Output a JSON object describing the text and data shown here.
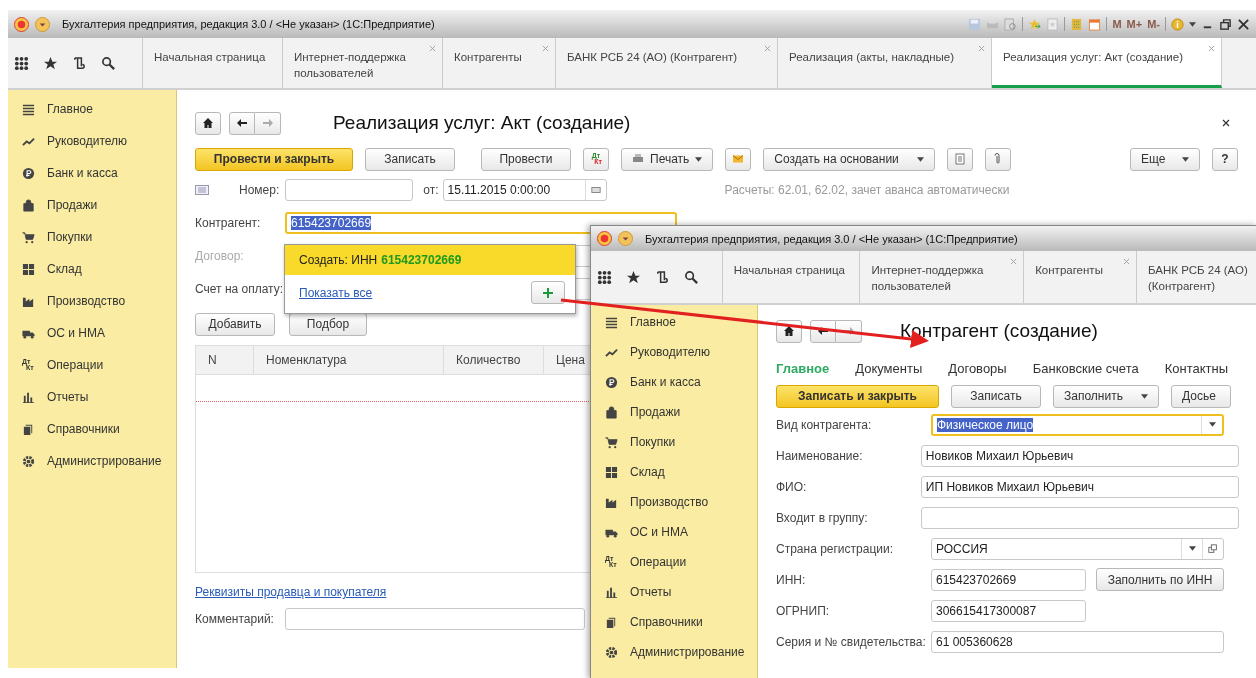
{
  "main_window": {
    "title": "Бухгалтерия предприятия, редакция 3.0 / <Не указан>  (1С:Предприятие)",
    "operations_glyph": [
      "Дт",
      "Кт"
    ],
    "memory_buttons": [
      "M",
      "M+",
      "M-"
    ],
    "tabs": [
      {
        "label": "Начальная страница",
        "selected": false,
        "closable": false
      },
      {
        "label": "Интернет-поддержка пользователей",
        "selected": false,
        "closable": true
      },
      {
        "label": "Контрагенты",
        "selected": false,
        "closable": true
      },
      {
        "label": "БАНК РСБ 24 (АО) (Контрагент)",
        "selected": false,
        "closable": true
      },
      {
        "label": "Реализация (акты, накладные)",
        "selected": false,
        "closable": true
      },
      {
        "label": "Реализация услуг: Акт (создание)",
        "selected": true,
        "closable": true
      }
    ],
    "sidebar": [
      "Главное",
      "Руководителю",
      "Банк и касса",
      "Продажи",
      "Покупки",
      "Склад",
      "Производство",
      "ОС и НМА",
      "Операции",
      "Отчеты",
      "Справочники",
      "Администрирование"
    ],
    "form": {
      "title": "Реализация услуг: Акт (создание)",
      "toolbar": {
        "post_close": "Провести и закрыть",
        "save": "Записать",
        "post": "Провести",
        "debit_credit": [
          "Дт",
          "Кт"
        ],
        "print": "Печать",
        "create_based": "Создать на основании",
        "more": "Еще",
        "help": "?"
      },
      "number_label": "Номер:",
      "date_label": "от:",
      "date_value": "15.11.2015  0:00:00",
      "settlements": "Расчеты: 62.01, 62.02, зачет аванса автоматически",
      "fields": [
        {
          "label": "Контрагент:",
          "value": "615423702669",
          "focused": true,
          "disabled": false
        },
        {
          "label": "Договор:",
          "focused": false,
          "disabled": true
        },
        {
          "label": "Счет на оплату:",
          "focused": false,
          "disabled": false
        }
      ],
      "popup": {
        "create_label": "Создать: ИНН",
        "create_value": "615423702669",
        "show_all": "Показать все"
      },
      "table_buttons": [
        "Добавить",
        "Подбор"
      ],
      "columns": [
        "N",
        "Номенклатура",
        "Количество",
        "Цена"
      ],
      "footer_link": "Реквизиты продавца и покупателя",
      "comment_label": "Комментарий:"
    }
  },
  "second_window": {
    "title": "Бухгалтерия предприятия, редакция 3.0 / <Не указан>  (1С:Предприятие)",
    "operations_glyph": [
      "Дт",
      "Кт"
    ],
    "tabs": [
      {
        "label": "Начальная страница",
        "selected": false,
        "closable": false
      },
      {
        "label": "Интернет-поддержка пользователей",
        "selected": false,
        "closable": true
      },
      {
        "label": "Контрагенты",
        "selected": false,
        "closable": true
      },
      {
        "label": "БАНК РСБ 24 (АО) (Контрагент)",
        "selected": false,
        "closable": false
      }
    ],
    "sidebar": [
      "Главное",
      "Руководителю",
      "Банк и касса",
      "Продажи",
      "Покупки",
      "Склад",
      "Производство",
      "ОС и НМА",
      "Операции",
      "Отчеты",
      "Справочники",
      "Администрирование"
    ],
    "form": {
      "title": "Контрагент (создание)",
      "sections": [
        {
          "label": "Главное",
          "selected": true
        },
        {
          "label": "Документы",
          "selected": false
        },
        {
          "label": "Договоры",
          "selected": false
        },
        {
          "label": "Банковские счета",
          "selected": false
        },
        {
          "label": "Контактны",
          "selected": false
        }
      ],
      "toolbar": {
        "save_close": "Записать и закрыть",
        "save": "Записать",
        "fill": "Заполнить",
        "dossier": "Досье"
      },
      "fields": [
        {
          "kind": "select",
          "label": "Вид контрагента:",
          "value": "Физическое лицо",
          "focused": true
        },
        {
          "kind": "wide",
          "label": "Наименование:",
          "value": "Новиков Михаил Юрьевич",
          "focused": false
        },
        {
          "kind": "wide",
          "label": "ФИО:",
          "value": "ИП Новиков Михаил Юрьевич",
          "focused": false
        },
        {
          "kind": "wide",
          "label": "Входит в группу:",
          "focused": false
        },
        {
          "kind": "select_open",
          "label": "Страна регистрации:",
          "value": "РОССИЯ",
          "focused": false
        },
        {
          "kind": "short_button",
          "label": "ИНН:",
          "value": "615423702669",
          "button": "Заполнить по ИНН",
          "focused": false
        },
        {
          "kind": "short",
          "label": "ОГРНИП:",
          "value": "306615417300087",
          "focused": false
        },
        {
          "kind": "medium",
          "label": "Серия и № свидетельства:",
          "value": "61 005360628",
          "focused": false
        }
      ]
    }
  }
}
